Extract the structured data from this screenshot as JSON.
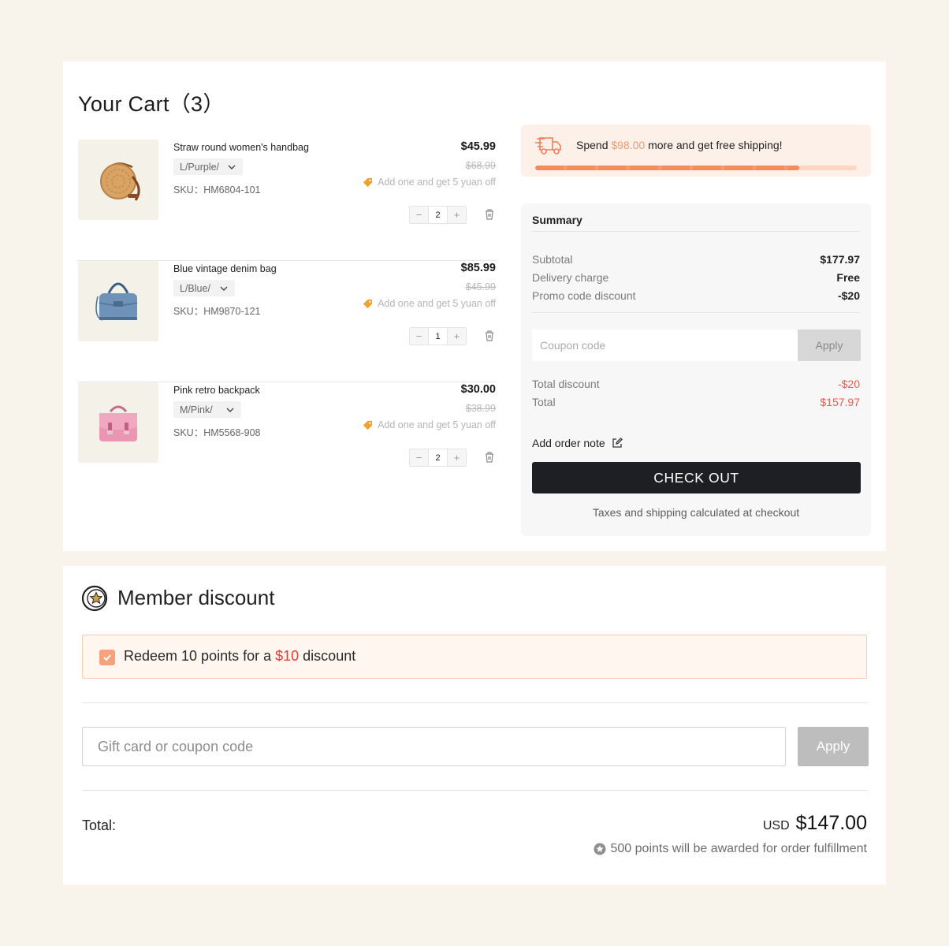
{
  "cart": {
    "title": "Your Cart（3）",
    "items": [
      {
        "name": "Straw round women's handbag",
        "variant": "L/Purple/",
        "sku": "SKU：HM6804-101",
        "price": "$45.99",
        "old_price": "$68.99",
        "promo": "Add one and get 5 yuan off",
        "quantity": "2",
        "image_icon": "straw-bag-icon"
      },
      {
        "name": "Blue vintage denim bag",
        "variant": "L/Blue/",
        "sku": "SKU：HM9870-121",
        "price": "$85.99",
        "old_price": "$45.99",
        "promo": "Add one and get 5 yuan off",
        "quantity": "1",
        "image_icon": "denim-bag-icon"
      },
      {
        "name": "Pink retro backpack",
        "variant": "M/Pink/",
        "sku": "SKU：HM5568-908",
        "price": "$30.00",
        "old_price": "$38.99",
        "promo": "Add one and get 5 yuan off",
        "quantity": "2",
        "image_icon": "pink-satchel-icon"
      }
    ],
    "stepper": {
      "minus": "−",
      "plus": "+"
    }
  },
  "shipping": {
    "prefix": "Spend ",
    "amount": "$98.00",
    "suffix": " more and get free shipping!",
    "progress_fraction": 0.82
  },
  "summary": {
    "title": "Summary",
    "subtotal_label": "Subtotal",
    "subtotal_value": "$177.97",
    "delivery_label": "Delivery charge",
    "delivery_value": "Free",
    "promo_label": "Promo code discount",
    "promo_value": "-$20",
    "coupon_placeholder": "Coupon code",
    "apply_label": "Apply",
    "total_discount_label": "Total discount",
    "total_discount_value": "-$20",
    "total_label": "Total",
    "total_value": "$157.97",
    "order_note_label": "Add order note",
    "checkout_label": "CHECK OUT",
    "taxes_note": "Taxes and shipping calculated at checkout"
  },
  "member": {
    "title": "Member discount",
    "redeem_prefix": "Redeem 10 points for a ",
    "redeem_amount": "$10",
    "redeem_suffix": " discount",
    "redeem_checked": true,
    "gift_placeholder": "Gift card or coupon code",
    "apply_label": "Apply",
    "total_label": "Total:",
    "currency": "USD",
    "total_value": "$147.00",
    "points_note": "500 points will be awarded for order fulfillment"
  },
  "colors": {
    "accent": "#f5a27e",
    "red": "#ef5a4d",
    "checkout_bg": "#1e1f23",
    "page_bg": "#f8f4ec"
  }
}
